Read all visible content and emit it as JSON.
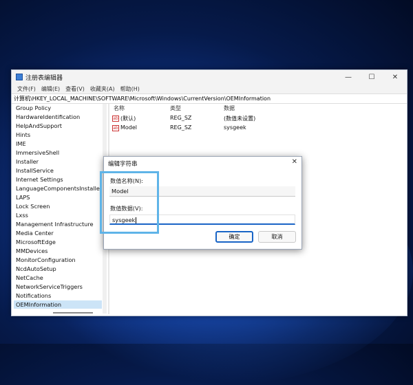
{
  "window": {
    "title": "注册表编辑器",
    "minimize": "—",
    "maximize": "☐",
    "close": "✕"
  },
  "menu": [
    "文件(F)",
    "编辑(E)",
    "查看(V)",
    "收藏夹(A)",
    "帮助(H)"
  ],
  "address": "计算机\\HKEY_LOCAL_MACHINE\\SOFTWARE\\Microsoft\\Windows\\CurrentVersion\\OEMInformation",
  "tree": {
    "items": [
      "Group Policy",
      "HardwareIdentification",
      "HelpAndSupport",
      "Hints",
      "IME",
      "ImmersiveShell",
      "Installer",
      "InstallService",
      "Internet Settings",
      "LanguageComponentsInstaller",
      "LAPS",
      "Lock Screen",
      "Lxss",
      "Management Infrastructure",
      "Media Center",
      "MicrosoftEdge",
      "MMDevices",
      "MonitorConfiguration",
      "NcdAutoSetup",
      "NetCache",
      "NetworkServiceTriggers",
      "Notifications",
      "OEMInformation"
    ],
    "selected": "OEMInformation"
  },
  "list": {
    "headers": {
      "name": "名称",
      "type": "类型",
      "data": "数据"
    },
    "rows": [
      {
        "name": "(默认)",
        "type": "REG_SZ",
        "data": "(数值未设置)"
      },
      {
        "name": "Model",
        "type": "REG_SZ",
        "data": "sysgeek"
      }
    ],
    "value_icon_text": "ab"
  },
  "dialog": {
    "title": "编辑字符串",
    "close": "✕",
    "name_label": "数值名称(N):",
    "name_value": "Model",
    "data_label": "数值数据(V):",
    "data_value": "sysgeek",
    "ok": "确定",
    "cancel": "取消"
  },
  "colors": {
    "accent": "#1864c6",
    "highlight": "#5fb4e8",
    "selected_row": "#cce4f7"
  }
}
